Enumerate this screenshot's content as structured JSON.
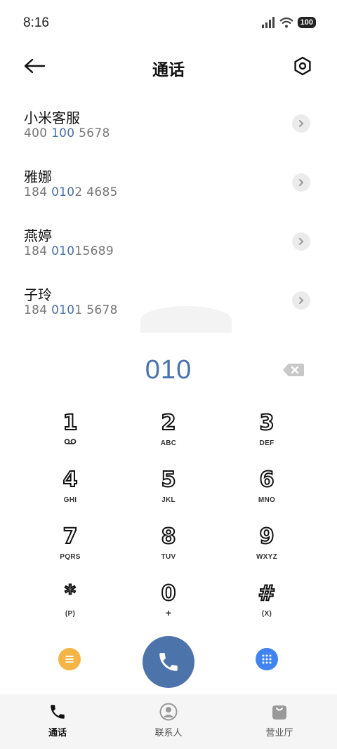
{
  "status": {
    "time": "8:16",
    "battery": "100"
  },
  "header": {
    "title": "通话"
  },
  "contacts": [
    {
      "name": "小米客服",
      "number_pre": "400 ",
      "number_hl": "100",
      "number_post": " 5678"
    },
    {
      "name": "雅娜",
      "number_pre": "184 ",
      "number_hl": "010",
      "number_post": "2 4685"
    },
    {
      "name": "燕婷",
      "number_pre": "184 ",
      "number_hl": "010",
      "number_post": "15689"
    },
    {
      "name": "子玲",
      "number_pre": "184 ",
      "number_hl": "010",
      "number_post": "1 5678"
    }
  ],
  "dialpad": {
    "typed_number": "010",
    "keys": [
      {
        "digit": "1",
        "sub": ""
      },
      {
        "digit": "2",
        "sub": "ABC"
      },
      {
        "digit": "3",
        "sub": "DEF"
      },
      {
        "digit": "4",
        "sub": "GHI"
      },
      {
        "digit": "5",
        "sub": "JKL"
      },
      {
        "digit": "6",
        "sub": "MNO"
      },
      {
        "digit": "7",
        "sub": "PQRS"
      },
      {
        "digit": "8",
        "sub": "TUV"
      },
      {
        "digit": "9",
        "sub": "WXYZ"
      },
      {
        "digit": "*",
        "sub": "(P)"
      },
      {
        "digit": "0",
        "sub": "+"
      },
      {
        "digit": "#",
        "sub": "(X)"
      }
    ]
  },
  "bottom_nav": [
    {
      "label": "通话",
      "icon": "phone-icon",
      "active": true
    },
    {
      "label": "联系人",
      "icon": "person-icon",
      "active": false
    },
    {
      "label": "营业厅",
      "icon": "shopping-bag-icon",
      "active": false
    }
  ],
  "colors": {
    "accent": "#4d73ab",
    "highlight": "#4a6fa5",
    "menu": "#f4b544",
    "grid": "#4183f0"
  }
}
